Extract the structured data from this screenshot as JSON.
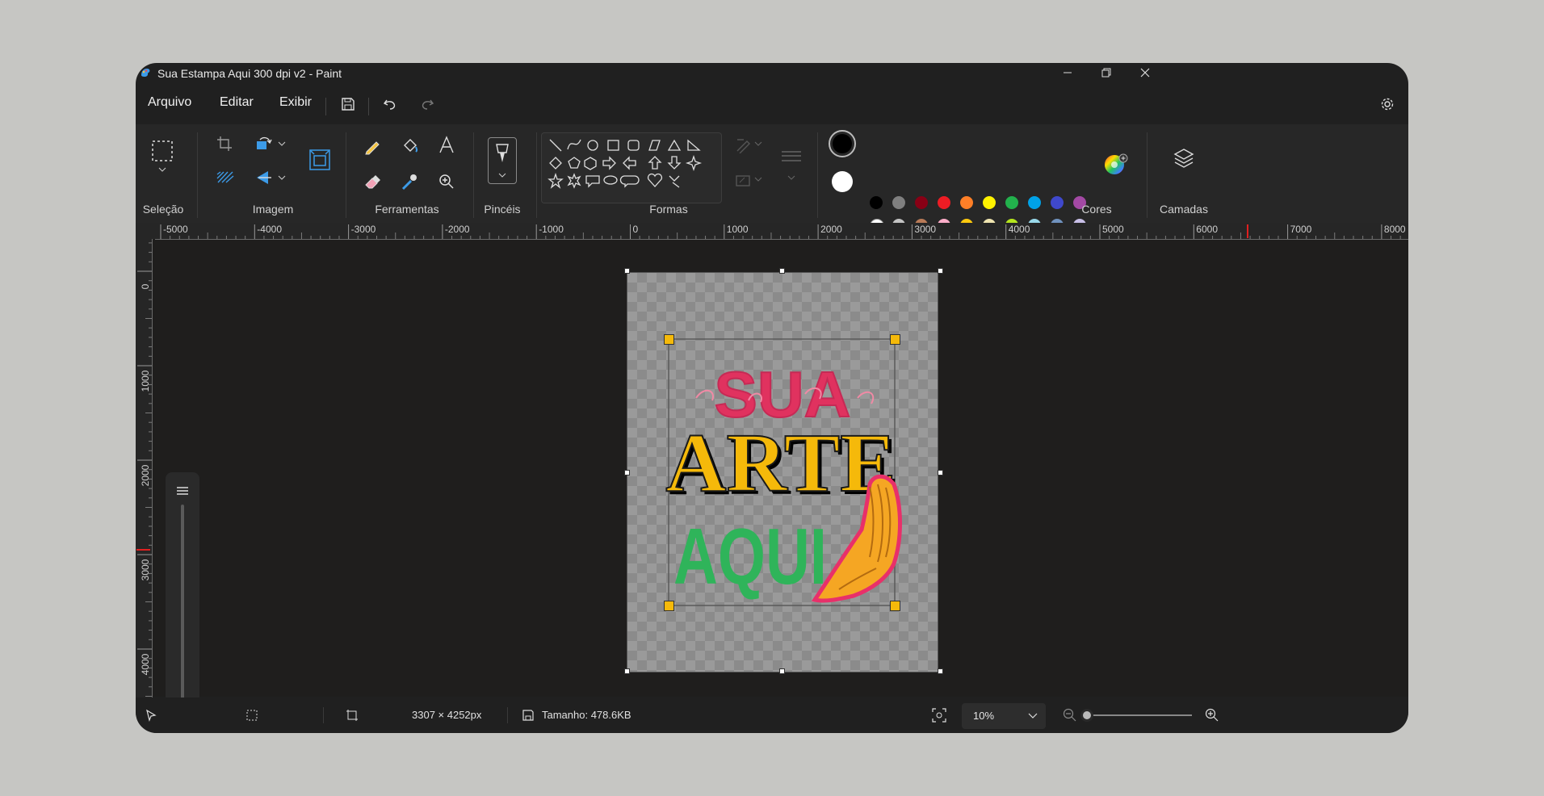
{
  "window": {
    "title": "Sua Estampa Aqui 300 dpi v2 - Paint"
  },
  "menu": {
    "items": [
      "Arquivo",
      "Editar",
      "Exibir"
    ]
  },
  "ribbon": {
    "groups": {
      "selection": "Seleção",
      "image": "Imagem",
      "tools": "Ferramentas",
      "brushes": "Pincéis",
      "shapes": "Formas",
      "colors": "Cores",
      "layers": "Camadas"
    },
    "palette_row1": [
      "#000000",
      "#7f7f7f",
      "#880015",
      "#ed1c24",
      "#ff7f27",
      "#fff200",
      "#22b14c",
      "#00a2e8",
      "#3f48cc",
      "#a349a4"
    ],
    "palette_row2": [
      "#ffffff",
      "#c3c3c3",
      "#b97a57",
      "#ffaec9",
      "#ffc90e",
      "#efe4b0",
      "#b5e61d",
      "#99d9ea",
      "#7092be",
      "#c8bfe7"
    ],
    "primary_color": "#000000",
    "secondary_color": "#ffffff"
  },
  "rulers": {
    "horizontal": [
      "-5000",
      "-4000",
      "-3000",
      "-2000",
      "-1000",
      "0",
      "1000",
      "2000",
      "3000",
      "4000",
      "5000",
      "6000",
      "7000",
      "8000"
    ],
    "vertical": [
      "0",
      "1000",
      "2000",
      "3000",
      "4000"
    ]
  },
  "artwork": {
    "line1": "SUA",
    "line2": "ARTE",
    "line3": "AQUI"
  },
  "status": {
    "dimensions": "3307 × 4252px",
    "size": "Tamanho: 478.6KB",
    "zoom": "10%"
  }
}
